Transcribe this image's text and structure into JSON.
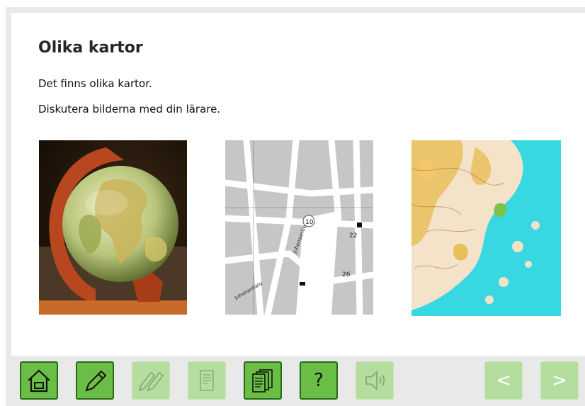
{
  "lesson": {
    "title": "Olika kartor",
    "paragraphs": [
      "Det finns olika kartor.",
      "Diskutera bilderna med din lärare."
    ]
  },
  "images": [
    {
      "name": "globe-photo",
      "kind": "globe"
    },
    {
      "name": "street-map",
      "kind": "street",
      "labels": [
        "10",
        "22",
        "26",
        "Juhanankatu",
        "Juhanaantie"
      ]
    },
    {
      "name": "topographic-map",
      "kind": "topographic"
    }
  ],
  "toolbar": {
    "buttons": [
      {
        "name": "home-button",
        "icon": "home-icon",
        "state": "active"
      },
      {
        "name": "edit-button",
        "icon": "pencil-icon",
        "state": "active"
      },
      {
        "name": "pencils-button",
        "icon": "pencils-icon",
        "state": "disabled"
      },
      {
        "name": "document-button",
        "icon": "document-icon",
        "state": "disabled"
      },
      {
        "name": "pages-button",
        "icon": "pages-icon",
        "state": "active"
      },
      {
        "name": "help-button",
        "icon": "question-icon",
        "state": "active",
        "label": "?"
      },
      {
        "name": "audio-button",
        "icon": "speaker-icon",
        "state": "disabled"
      },
      {
        "name": "previous-button",
        "icon": "chevron-left-icon",
        "state": "disabled",
        "label": "<"
      },
      {
        "name": "next-button",
        "icon": "chevron-right-icon",
        "state": "disabled",
        "label": ">"
      }
    ]
  },
  "colors": {
    "button_active": "#6abd45",
    "button_active_border": "#2a6a16",
    "button_disabled": "#b4dd9f",
    "frame": "#e9e9e9"
  }
}
